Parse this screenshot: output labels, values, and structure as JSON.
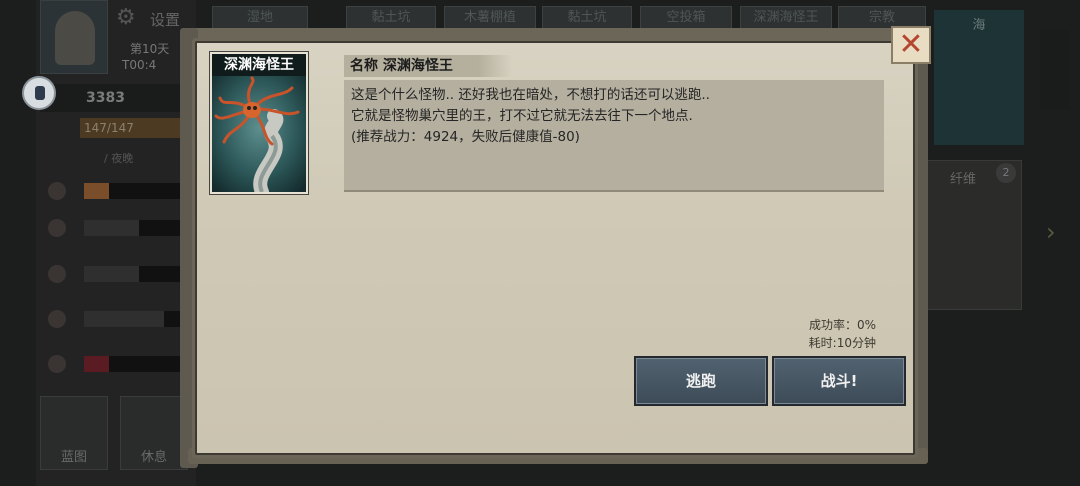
{
  "background": {
    "settings_label": "设置",
    "day": "第10天",
    "time": "T00:4",
    "power": "3383",
    "health": "147/147",
    "season": "/ 夜晚",
    "tabs": [
      "湿地",
      "黏土坑",
      "木薯棚植",
      "黏土坑",
      "空投箱",
      "深渊海怪王",
      "宗教"
    ],
    "sea_label": "海",
    "fiber_label": "纤维",
    "fiber_count": "2",
    "blueprint_label": "蓝图",
    "rest_label": "休息",
    "stat_bars": [
      {
        "icon": "hunger-icon",
        "fill": 0.25,
        "color": "#7a4e2a"
      },
      {
        "icon": "bread-icon",
        "fill": 0.55,
        "color": "#2f2f2f"
      },
      {
        "icon": "water-drop-icon",
        "fill": 0.55,
        "color": "#2f2f2f"
      },
      {
        "icon": "eye-icon",
        "fill": 0.8,
        "color": "#2f2f2f"
      },
      {
        "icon": "muscle-icon",
        "fill": 0.25,
        "color": "#5a1c22"
      }
    ]
  },
  "dialog": {
    "monster_name": "深渊海怪王",
    "name_label": "名称  深渊海怪王",
    "description": [
      "这是个什么怪物..   还好我也在暗处，不想打的话还可以逃跑..",
      "它就是怪物巢穴里的王，打不过它就无法去往下一个地点.",
      "(推荐战力：4924，失败后健康值-80)"
    ],
    "success_rate": "成功率：0%",
    "time_cost": "耗时:10分钟",
    "flee_label": "逃跑",
    "fight_label": "战斗!",
    "close_icon": "✕"
  },
  "colors": {
    "button": "#47566 3",
    "paper": "#d5cfbd",
    "close": "#b4452e"
  }
}
